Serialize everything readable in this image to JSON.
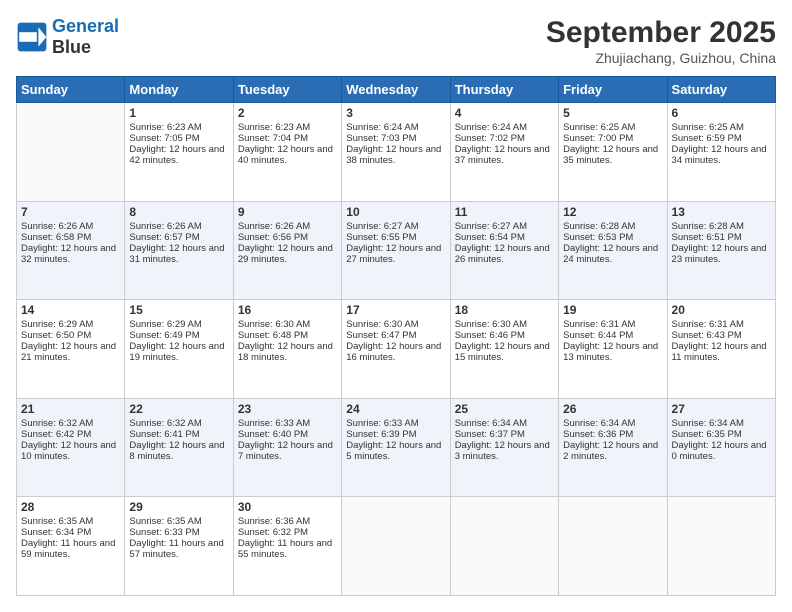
{
  "header": {
    "logo_line1": "General",
    "logo_line2": "Blue",
    "month": "September 2025",
    "location": "Zhujiachang, Guizhou, China"
  },
  "weekdays": [
    "Sunday",
    "Monday",
    "Tuesday",
    "Wednesday",
    "Thursday",
    "Friday",
    "Saturday"
  ],
  "weeks": [
    [
      {
        "day": "",
        "text": ""
      },
      {
        "day": "1",
        "text": "Sunrise: 6:23 AM\nSunset: 7:05 PM\nDaylight: 12 hours and 42 minutes."
      },
      {
        "day": "2",
        "text": "Sunrise: 6:23 AM\nSunset: 7:04 PM\nDaylight: 12 hours and 40 minutes."
      },
      {
        "day": "3",
        "text": "Sunrise: 6:24 AM\nSunset: 7:03 PM\nDaylight: 12 hours and 38 minutes."
      },
      {
        "day": "4",
        "text": "Sunrise: 6:24 AM\nSunset: 7:02 PM\nDaylight: 12 hours and 37 minutes."
      },
      {
        "day": "5",
        "text": "Sunrise: 6:25 AM\nSunset: 7:00 PM\nDaylight: 12 hours and 35 minutes."
      },
      {
        "day": "6",
        "text": "Sunrise: 6:25 AM\nSunset: 6:59 PM\nDaylight: 12 hours and 34 minutes."
      }
    ],
    [
      {
        "day": "7",
        "text": "Sunrise: 6:26 AM\nSunset: 6:58 PM\nDaylight: 12 hours and 32 minutes."
      },
      {
        "day": "8",
        "text": "Sunrise: 6:26 AM\nSunset: 6:57 PM\nDaylight: 12 hours and 31 minutes."
      },
      {
        "day": "9",
        "text": "Sunrise: 6:26 AM\nSunset: 6:56 PM\nDaylight: 12 hours and 29 minutes."
      },
      {
        "day": "10",
        "text": "Sunrise: 6:27 AM\nSunset: 6:55 PM\nDaylight: 12 hours and 27 minutes."
      },
      {
        "day": "11",
        "text": "Sunrise: 6:27 AM\nSunset: 6:54 PM\nDaylight: 12 hours and 26 minutes."
      },
      {
        "day": "12",
        "text": "Sunrise: 6:28 AM\nSunset: 6:53 PM\nDaylight: 12 hours and 24 minutes."
      },
      {
        "day": "13",
        "text": "Sunrise: 6:28 AM\nSunset: 6:51 PM\nDaylight: 12 hours and 23 minutes."
      }
    ],
    [
      {
        "day": "14",
        "text": "Sunrise: 6:29 AM\nSunset: 6:50 PM\nDaylight: 12 hours and 21 minutes."
      },
      {
        "day": "15",
        "text": "Sunrise: 6:29 AM\nSunset: 6:49 PM\nDaylight: 12 hours and 19 minutes."
      },
      {
        "day": "16",
        "text": "Sunrise: 6:30 AM\nSunset: 6:48 PM\nDaylight: 12 hours and 18 minutes."
      },
      {
        "day": "17",
        "text": "Sunrise: 6:30 AM\nSunset: 6:47 PM\nDaylight: 12 hours and 16 minutes."
      },
      {
        "day": "18",
        "text": "Sunrise: 6:30 AM\nSunset: 6:46 PM\nDaylight: 12 hours and 15 minutes."
      },
      {
        "day": "19",
        "text": "Sunrise: 6:31 AM\nSunset: 6:44 PM\nDaylight: 12 hours and 13 minutes."
      },
      {
        "day": "20",
        "text": "Sunrise: 6:31 AM\nSunset: 6:43 PM\nDaylight: 12 hours and 11 minutes."
      }
    ],
    [
      {
        "day": "21",
        "text": "Sunrise: 6:32 AM\nSunset: 6:42 PM\nDaylight: 12 hours and 10 minutes."
      },
      {
        "day": "22",
        "text": "Sunrise: 6:32 AM\nSunset: 6:41 PM\nDaylight: 12 hours and 8 minutes."
      },
      {
        "day": "23",
        "text": "Sunrise: 6:33 AM\nSunset: 6:40 PM\nDaylight: 12 hours and 7 minutes."
      },
      {
        "day": "24",
        "text": "Sunrise: 6:33 AM\nSunset: 6:39 PM\nDaylight: 12 hours and 5 minutes."
      },
      {
        "day": "25",
        "text": "Sunrise: 6:34 AM\nSunset: 6:37 PM\nDaylight: 12 hours and 3 minutes."
      },
      {
        "day": "26",
        "text": "Sunrise: 6:34 AM\nSunset: 6:36 PM\nDaylight: 12 hours and 2 minutes."
      },
      {
        "day": "27",
        "text": "Sunrise: 6:34 AM\nSunset: 6:35 PM\nDaylight: 12 hours and 0 minutes."
      }
    ],
    [
      {
        "day": "28",
        "text": "Sunrise: 6:35 AM\nSunset: 6:34 PM\nDaylight: 11 hours and 59 minutes."
      },
      {
        "day": "29",
        "text": "Sunrise: 6:35 AM\nSunset: 6:33 PM\nDaylight: 11 hours and 57 minutes."
      },
      {
        "day": "30",
        "text": "Sunrise: 6:36 AM\nSunset: 6:32 PM\nDaylight: 11 hours and 55 minutes."
      },
      {
        "day": "",
        "text": ""
      },
      {
        "day": "",
        "text": ""
      },
      {
        "day": "",
        "text": ""
      },
      {
        "day": "",
        "text": ""
      }
    ]
  ]
}
